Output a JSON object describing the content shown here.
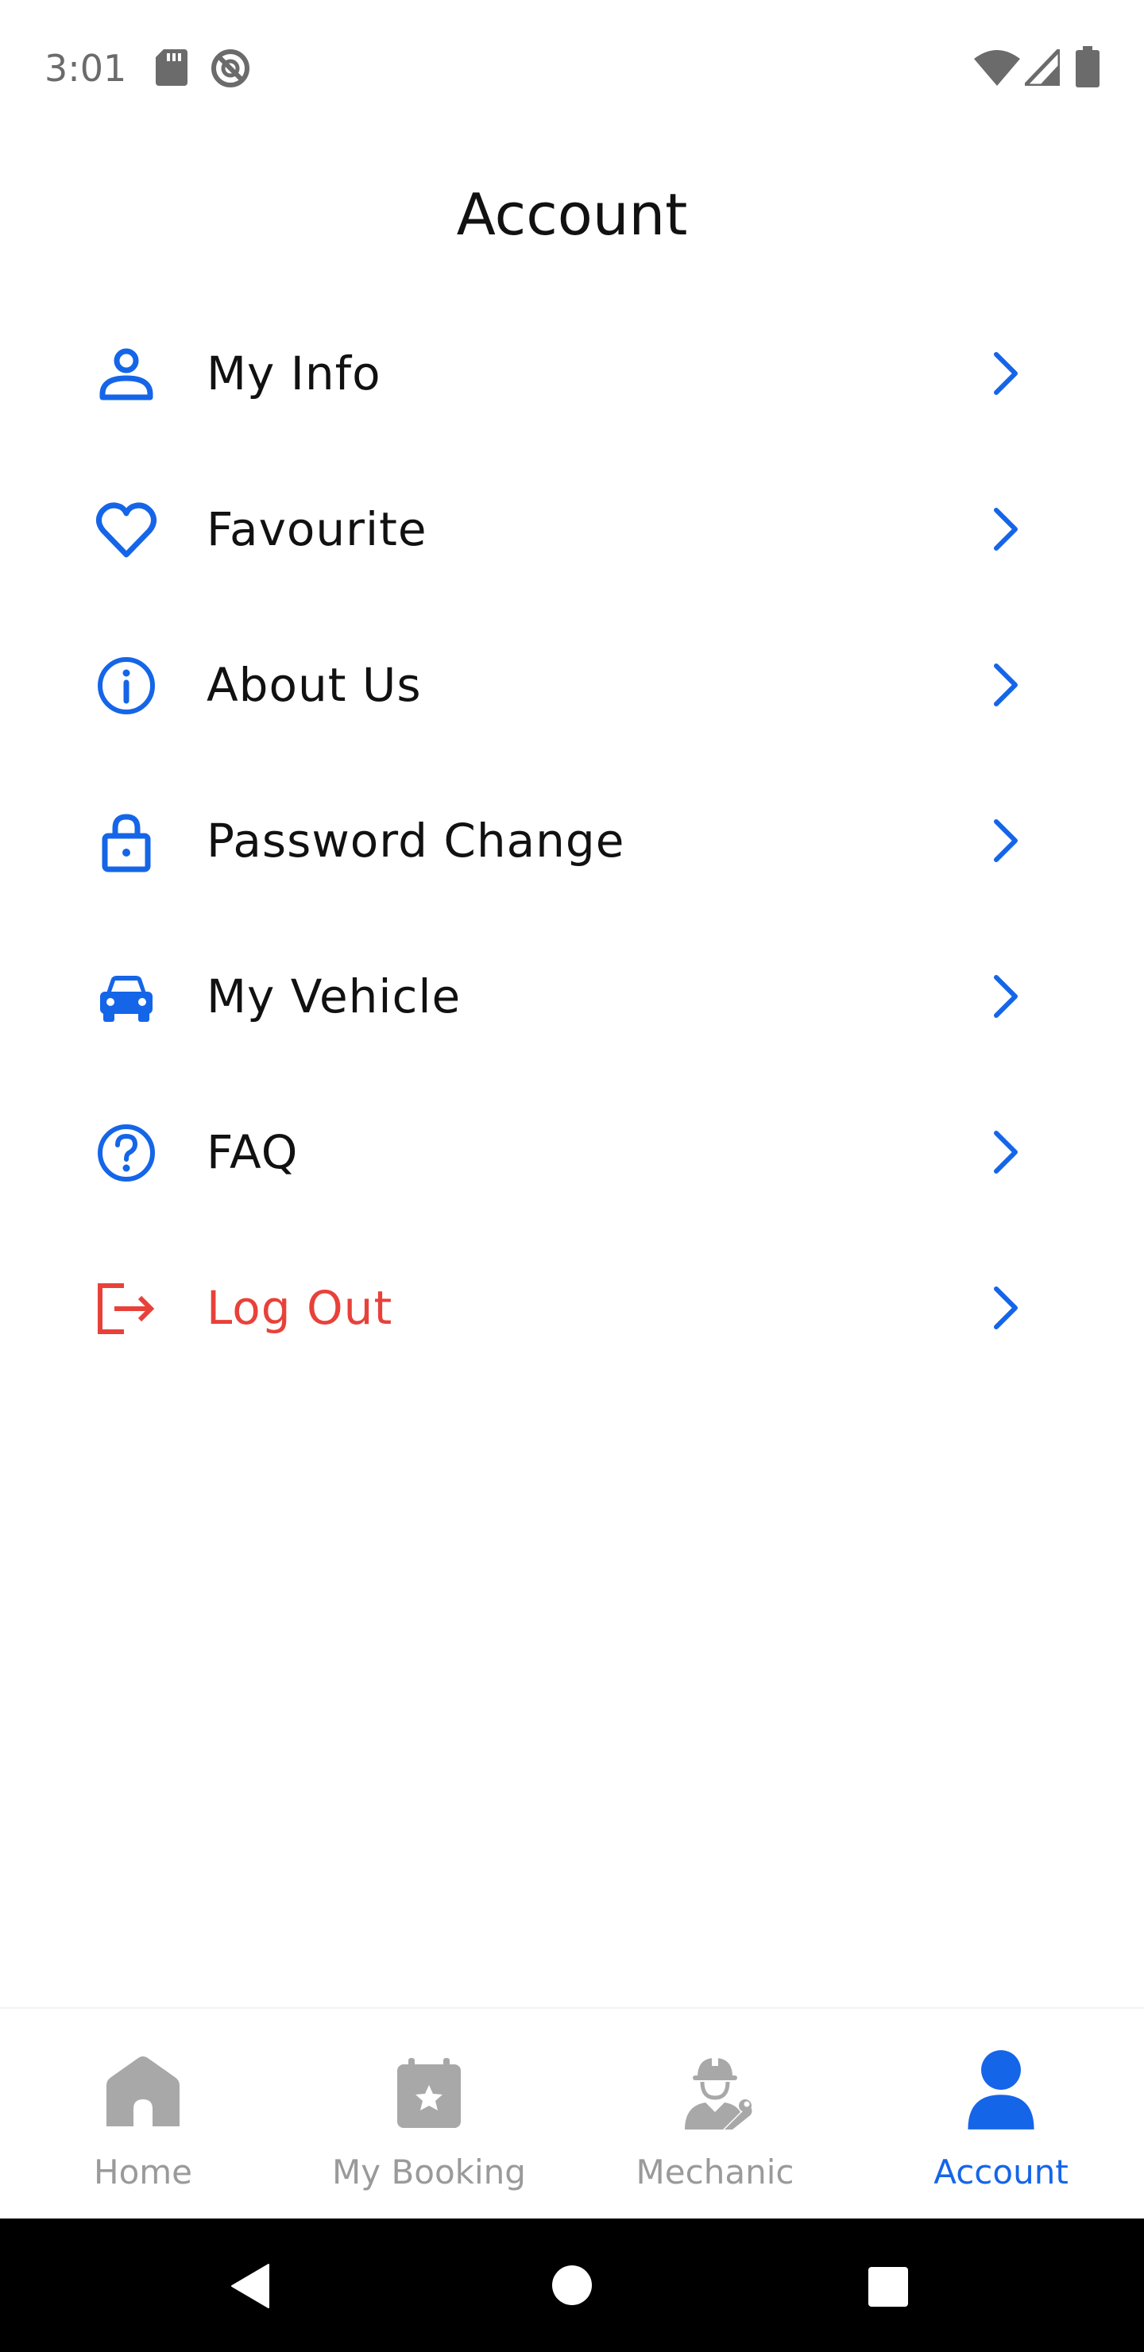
{
  "status_bar": {
    "time": "3:01",
    "left_icons": [
      "sd-card-icon",
      "do-not-disturb-icon"
    ],
    "right_icons": [
      "wifi-icon",
      "cell-signal-icon",
      "battery-icon"
    ]
  },
  "header": {
    "title": "Account"
  },
  "menu": {
    "items": [
      {
        "label": "My Info",
        "icon": "person-icon"
      },
      {
        "label": "Favourite",
        "icon": "heart-icon"
      },
      {
        "label": "About Us",
        "icon": "info-icon"
      },
      {
        "label": "Password Change",
        "icon": "lock-icon"
      },
      {
        "label": "My Vehicle",
        "icon": "car-icon"
      },
      {
        "label": "FAQ",
        "icon": "help-circle-icon"
      },
      {
        "label": "Log Out",
        "icon": "logout-icon"
      }
    ]
  },
  "bottom_nav": {
    "tabs": [
      {
        "label": "Home",
        "icon": "home-icon",
        "active": false
      },
      {
        "label": "My Booking",
        "icon": "calendar-star-icon",
        "active": false
      },
      {
        "label": "Mechanic",
        "icon": "mechanic-icon",
        "active": false
      },
      {
        "label": "Account",
        "icon": "account-icon",
        "active": true
      }
    ]
  },
  "system_nav": {
    "buttons": [
      "back-icon",
      "home-circle-icon",
      "recents-icon"
    ]
  },
  "colors": {
    "accent": "#1565e8",
    "danger": "#e8413a",
    "inactive": "#9a9a9a",
    "text": "#111111"
  }
}
